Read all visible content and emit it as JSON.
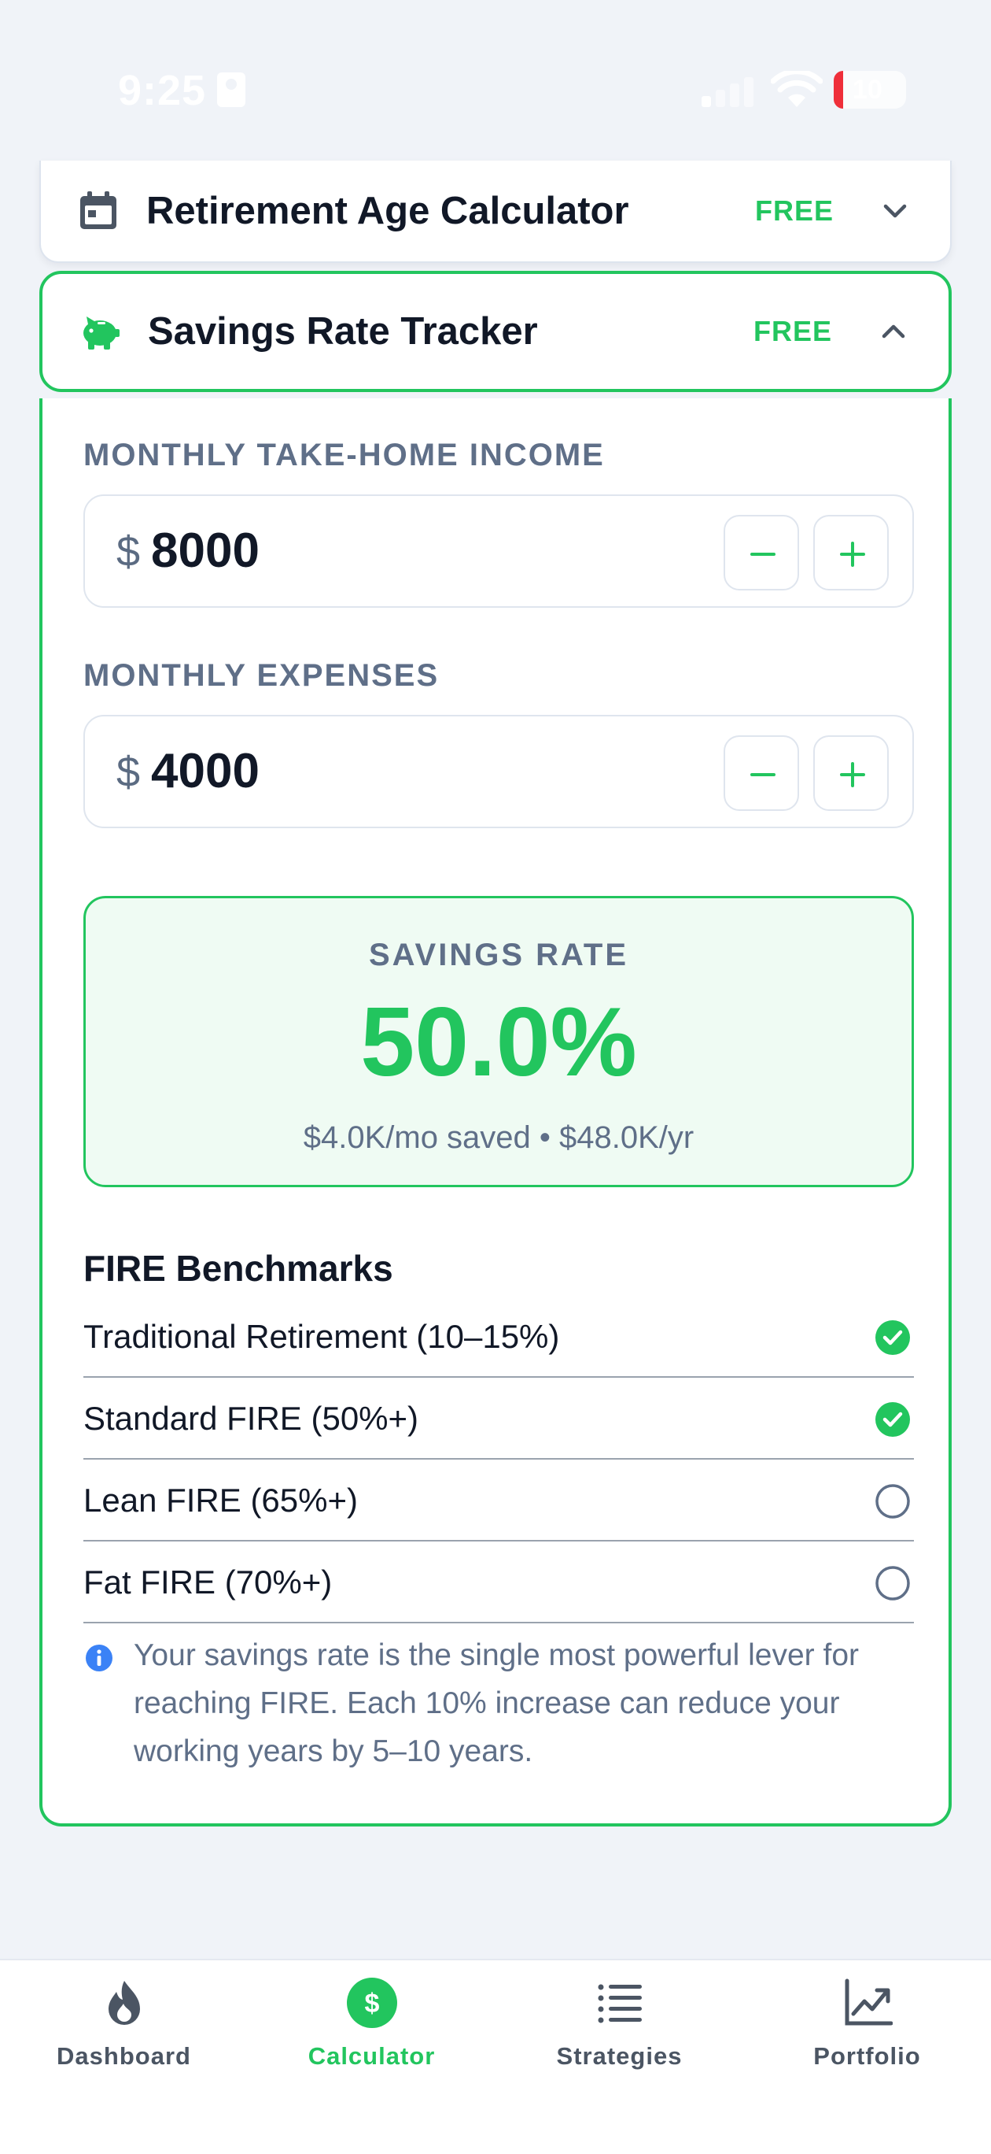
{
  "status_bar": {
    "time": "9:25",
    "battery": "10"
  },
  "calculators": {
    "retirement": {
      "title": "Retirement Age Calculator",
      "badge": "FREE",
      "icon": "calendar-icon",
      "expanded": false
    },
    "savings": {
      "title": "Savings Rate Tracker",
      "badge": "FREE",
      "icon": "piggy-bank-icon",
      "expanded": true
    }
  },
  "savings_tracker": {
    "income": {
      "label": "MONTHLY TAKE-HOME INCOME",
      "currency": "$",
      "value": "8000"
    },
    "expenses": {
      "label": "MONTHLY EXPENSES",
      "currency": "$",
      "value": "4000"
    },
    "result": {
      "label": "SAVINGS RATE",
      "value": "50.0%",
      "subtitle": "$4.0K/mo saved • $48.0K/yr"
    },
    "benchmarks_title": "FIRE Benchmarks",
    "benchmarks": [
      {
        "label": "Traditional Retirement (10–15%)",
        "achieved": true
      },
      {
        "label": "Standard FIRE (50%+)",
        "achieved": true
      },
      {
        "label": "Lean FIRE (65%+)",
        "achieved": false
      },
      {
        "label": "Fat FIRE (70%+)",
        "achieved": false
      }
    ],
    "info": "Your savings rate is the single most powerful lever for reaching FIRE. Each 10% increase can reduce your working years by 5–10 years."
  },
  "tab_bar": {
    "tabs": [
      {
        "label": "Dashboard",
        "icon": "flame-icon",
        "active": false
      },
      {
        "label": "Calculator",
        "icon": "dollar-icon",
        "active": true
      },
      {
        "label": "Strategies",
        "icon": "list-icon",
        "active": false
      },
      {
        "label": "Portfolio",
        "icon": "chart-icon",
        "active": false
      }
    ]
  },
  "colors": {
    "accent": "#22c55e",
    "accent_bg": "#effbf3",
    "muted_text": "#5f6f88",
    "background": "#f0f3f8"
  }
}
